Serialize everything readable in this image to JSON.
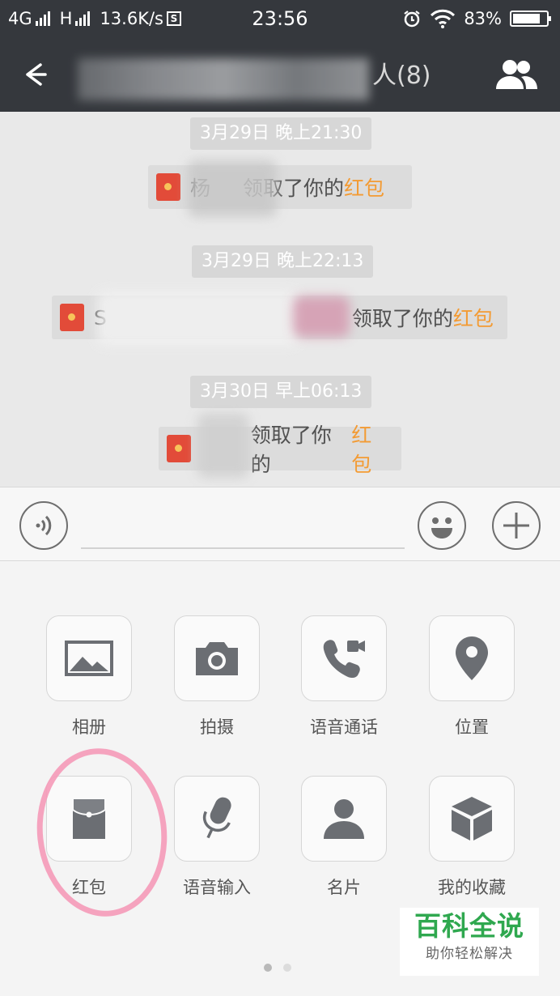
{
  "status_bar": {
    "network1": "4G",
    "network2": "H",
    "speed": "13.6K/s",
    "s_badge": "S",
    "time": "23:56",
    "battery": "83%",
    "battery_level": 0.83
  },
  "header": {
    "title_visible": "人",
    "member_count": "(8)"
  },
  "chat": {
    "messages": [
      {
        "time": "3月29日 晚上21:30",
        "name": "杨",
        "action": "领取了你的",
        "highlight": "红包"
      },
      {
        "time": "3月29日 晚上22:13",
        "name": "S",
        "action": "领取了你的",
        "highlight": "红包"
      },
      {
        "time": "3月30日 早上06:13",
        "name": "",
        "action": "领取了你的",
        "highlight": "红包"
      }
    ]
  },
  "input": {
    "placeholder": ""
  },
  "panel": {
    "items": [
      {
        "label": "相册",
        "icon": "album-icon"
      },
      {
        "label": "拍摄",
        "icon": "camera-icon"
      },
      {
        "label": "语音通话",
        "icon": "voice-call-icon"
      },
      {
        "label": "位置",
        "icon": "location-icon"
      },
      {
        "label": "红包",
        "icon": "red-packet-icon"
      },
      {
        "label": "语音输入",
        "icon": "microphone-icon"
      },
      {
        "label": "名片",
        "icon": "contact-card-icon"
      },
      {
        "label": "我的收藏",
        "icon": "favorites-box-icon"
      }
    ],
    "page": 1,
    "pages": 2
  },
  "watermark": {
    "title": "百科全说",
    "subtitle": "助你轻松解决"
  },
  "colors": {
    "topbar": "#35383d",
    "highlight": "#f39b34",
    "red_packet": "#e24b39",
    "icon_gray": "#6b6e73",
    "annotation": "#f59ab8",
    "watermark": "#2fa84f"
  }
}
